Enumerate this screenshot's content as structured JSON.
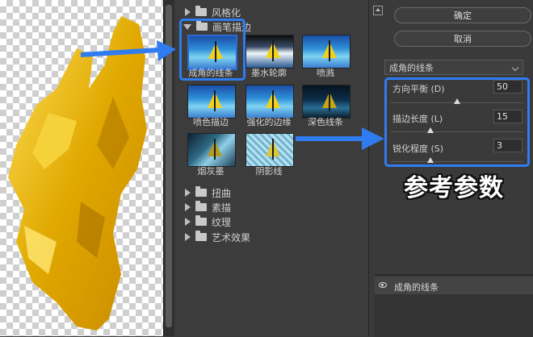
{
  "dialog": {
    "ok_button": "确定",
    "cancel_button": "取消",
    "filter_select_value": "成角的线条"
  },
  "gallery": {
    "folders": [
      {
        "id": "stylize",
        "label": "风格化",
        "open": false
      },
      {
        "id": "brush-strokes",
        "label": "画笔描边",
        "open": true
      },
      {
        "id": "distort",
        "label": "扭曲",
        "open": false
      },
      {
        "id": "sketch",
        "label": "素描",
        "open": false
      },
      {
        "id": "texture",
        "label": "纹理",
        "open": false
      },
      {
        "id": "artistic",
        "label": "艺术效果",
        "open": false
      }
    ],
    "filters": [
      {
        "label": "成角的线条",
        "selected": true
      },
      {
        "label": "墨水轮廓",
        "selected": false
      },
      {
        "label": "喷溅",
        "selected": false
      },
      {
        "label": "喷色描边",
        "selected": false
      },
      {
        "label": "强化的边缘",
        "selected": false
      },
      {
        "label": "深色线条",
        "selected": false
      },
      {
        "label": "烟灰墨",
        "selected": false
      },
      {
        "label": "阴影线",
        "selected": false
      }
    ]
  },
  "params": [
    {
      "label": "方向平衡 (D)",
      "value": "50",
      "level": 0.5
    },
    {
      "label": "描边长度 (L)",
      "value": "15",
      "level": 0.3
    },
    {
      "label": "锐化程度 (S)",
      "value": "3",
      "level": 0.3
    }
  ],
  "annotation": {
    "caption": "参考参数"
  },
  "layers": {
    "row_label": "成角的线条"
  },
  "colors": {
    "highlight": "#2f7cf0",
    "panel_bg": "#3a3a3a",
    "accent_yellow": "#f2c21a"
  }
}
